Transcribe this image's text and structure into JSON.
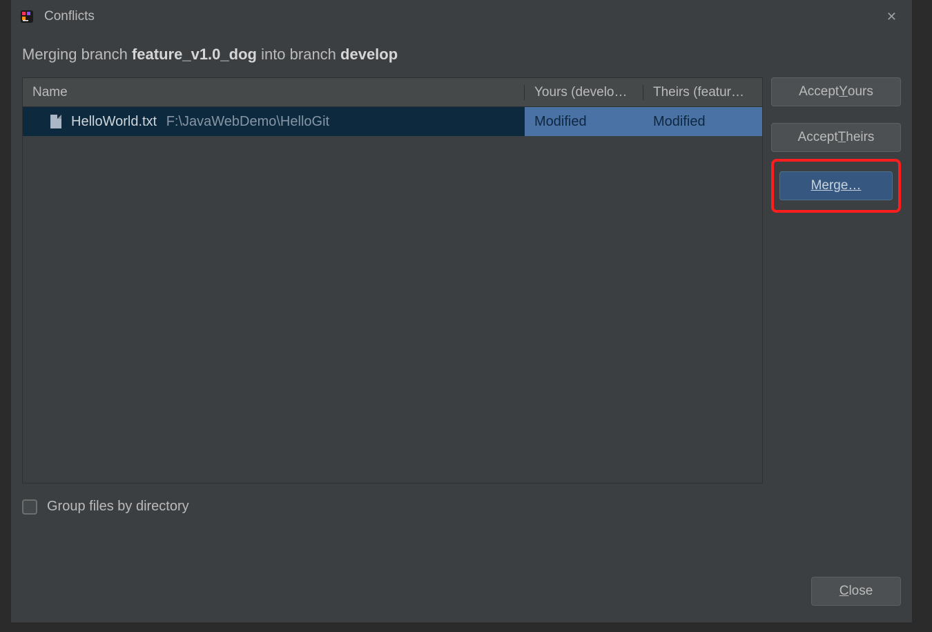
{
  "title": "Conflicts",
  "merge_message": {
    "prefix": "Merging branch ",
    "branch_from": "feature_v1.0_dog",
    "middle": " into branch ",
    "branch_to": "develop"
  },
  "table": {
    "headers": {
      "name": "Name",
      "yours": "Yours (develo…",
      "theirs": "Theirs (featur…"
    },
    "rows": [
      {
        "filename": "HelloWorld.txt",
        "path": "F:\\JavaWebDemo\\HelloGit",
        "yours": "Modified",
        "theirs": "Modified"
      }
    ]
  },
  "buttons": {
    "accept_yours_pre": "Accept ",
    "accept_yours_mn": "Y",
    "accept_yours_post": "ours",
    "accept_theirs_pre": "Accept ",
    "accept_theirs_mn": "T",
    "accept_theirs_post": "heirs",
    "merge_mn": "M",
    "merge_post": "erge…",
    "close_mn": "C",
    "close_post": "lose"
  },
  "checkbox": {
    "label": "Group files by directory"
  }
}
